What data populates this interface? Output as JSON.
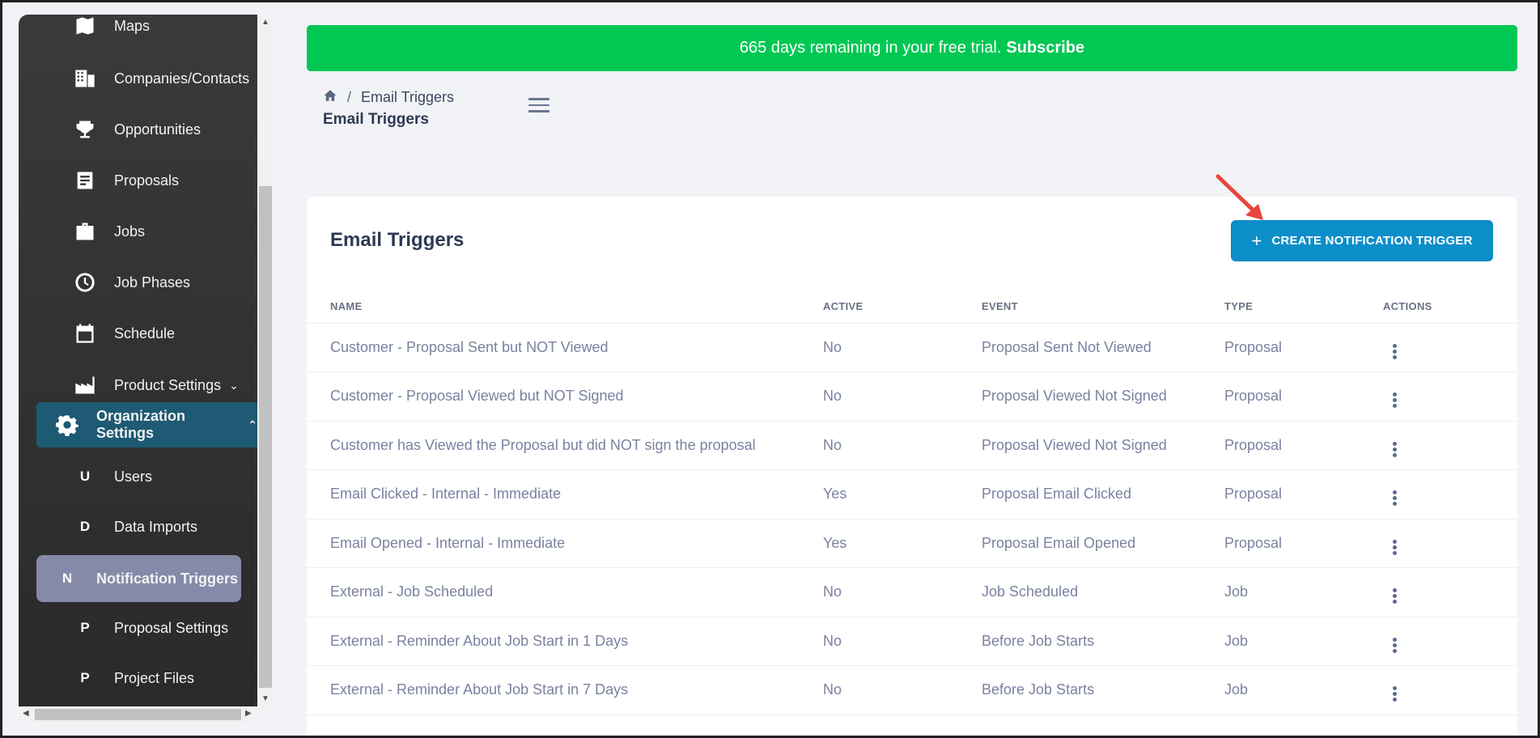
{
  "banner": {
    "text": "665 days remaining in your free trial.",
    "link": "Subscribe",
    "color": "#00c853"
  },
  "breadcrumb": {
    "current": "Email Triggers",
    "separator": "/"
  },
  "page_title": "Email Triggers",
  "sidebar": {
    "items": [
      {
        "label": "Maps",
        "icon": "map-icon"
      },
      {
        "label": "Companies/Contacts",
        "icon": "building-icon"
      },
      {
        "label": "Opportunities",
        "icon": "trophy-icon"
      },
      {
        "label": "Proposals",
        "icon": "document-icon"
      },
      {
        "label": "Jobs",
        "icon": "briefcase-icon"
      },
      {
        "label": "Job Phases",
        "icon": "clock-icon"
      },
      {
        "label": "Schedule",
        "icon": "calendar-icon"
      },
      {
        "label": "Product Settings",
        "icon": "factory-icon"
      },
      {
        "label": "Organization Settings",
        "icon": "gear-icon"
      }
    ],
    "sub_items": [
      {
        "letter": "U",
        "label": "Users"
      },
      {
        "letter": "D",
        "label": "Data Imports"
      },
      {
        "letter": "N",
        "label": "Notification Triggers"
      },
      {
        "letter": "P",
        "label": "Proposal Settings"
      },
      {
        "letter": "P",
        "label": "Project Files"
      }
    ]
  },
  "card": {
    "title": "Email Triggers",
    "create_button": "CREATE NOTIFICATION TRIGGER",
    "button_color": "#0c8ec9"
  },
  "table": {
    "headers": [
      "NAME",
      "ACTIVE",
      "EVENT",
      "TYPE",
      "ACTIONS"
    ],
    "rows": [
      [
        "Customer - Proposal Sent but NOT Viewed",
        "No",
        "Proposal Sent Not Viewed",
        "Proposal"
      ],
      [
        "Customer - Proposal Viewed but NOT Signed",
        "No",
        "Proposal Viewed Not Signed",
        "Proposal"
      ],
      [
        "Customer has Viewed the Proposal but did NOT sign the proposal",
        "No",
        "Proposal Viewed Not Signed",
        "Proposal"
      ],
      [
        "Email Clicked - Internal - Immediate",
        "Yes",
        "Proposal Email Clicked",
        "Proposal"
      ],
      [
        "Email Opened - Internal - Immediate",
        "Yes",
        "Proposal Email Opened",
        "Proposal"
      ],
      [
        "External - Job Scheduled",
        "No",
        "Job Scheduled",
        "Job"
      ],
      [
        "External - Reminder About Job Start in 1 Days",
        "No",
        "Before Job Starts",
        "Job"
      ],
      [
        "External - Reminder About Job Start in 7 Days",
        "No",
        "Before Job Starts",
        "Job"
      ]
    ]
  }
}
